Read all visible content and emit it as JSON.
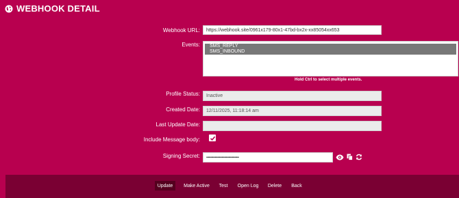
{
  "header": {
    "title": "WEBHOOK DETAIL",
    "icon": "globe-icon"
  },
  "form": {
    "webhook_url_label": "Webhook URL:",
    "webhook_url_value": "https://webhook.site/0961x179-80x1-47bd-bx2x-xx85054xx653",
    "events_label": "Events:",
    "events": [
      "SMS_REPLY",
      "SMS_INBOUND"
    ],
    "events_hint": "Hold Ctrl to select multiple events.",
    "profile_status_label": "Profile Status:",
    "profile_status_value": "Inactive",
    "created_date_label": "Created Date:",
    "created_date_value": "12/11/2025, 11:18:14 am",
    "last_update_label": "Last Update Date:",
    "last_update_value": "",
    "include_body_label": "Include Message body:",
    "include_body_checked": true,
    "signing_secret_label": "Signing Secret:",
    "signing_secret_value": "••••••••••••••••••••••••••••••••••••••"
  },
  "footer": {
    "update": "Update",
    "make_active": "Make Active",
    "test": "Test",
    "open_log": "Open Log",
    "delete": "Delete",
    "back": "Back"
  },
  "colors": {
    "background": "#b8004f",
    "footer": "#7a0033",
    "selected_option": "#787878"
  }
}
